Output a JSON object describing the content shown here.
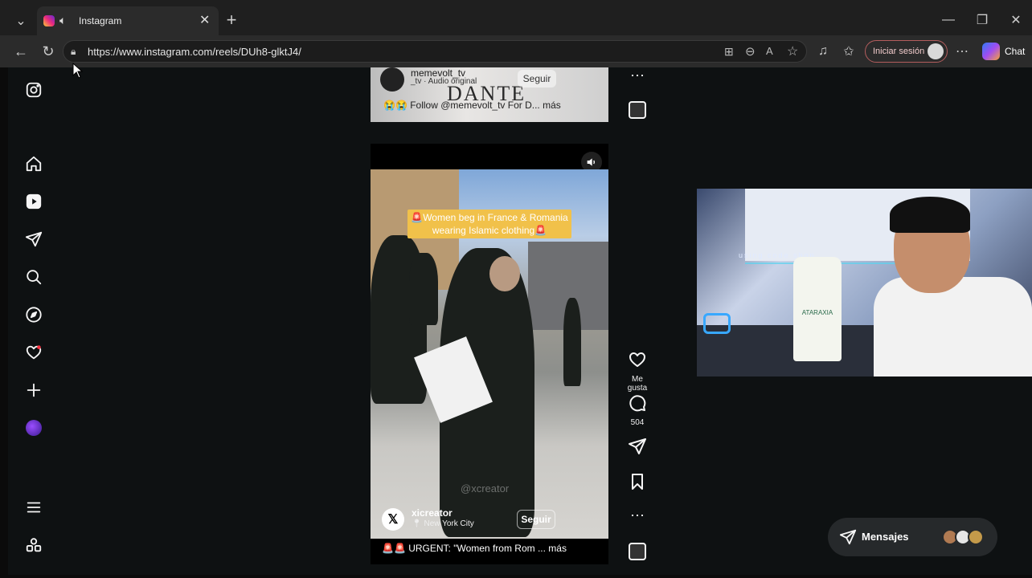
{
  "browser": {
    "tab_title": "Instagram",
    "url": "https://www.instagram.com/reels/DUh8-glktJ4/",
    "signin_label": "Iniciar sesión",
    "chat_label": "Chat"
  },
  "sidebar": {
    "items": [
      "instagram-logo",
      "home",
      "reels",
      "messages",
      "search",
      "explore",
      "notifications",
      "create",
      "profile",
      "more",
      "also-from-meta"
    ]
  },
  "reel_previous": {
    "account": "memevolt_tv",
    "audio": "_tv · Audio original",
    "follow": "Seguir",
    "caption": "😭😭 Follow @memevolt_tv For D... más",
    "overlay_word": "DANTE"
  },
  "reel_current": {
    "overlay_text": "🚨Women beg in France & Romania wearing Islamic clothing🚨",
    "watermark": "@xcreator",
    "account": "xicreator",
    "location": "New York City",
    "follow": "Seguir",
    "caption": "🚨🚨 URGENT: \"Women from Rom ... más"
  },
  "actions": {
    "like_label": "Me gusta",
    "comment_count": "504"
  },
  "webcam": {
    "bottle_text": "ATARAXIA",
    "sign_text": "using code shop"
  },
  "messages": {
    "label": "Mensajes"
  },
  "colors": {
    "page_bg": "#0e1112",
    "accent_notif": "#ff3040",
    "caption_band": "#f1c14a"
  }
}
